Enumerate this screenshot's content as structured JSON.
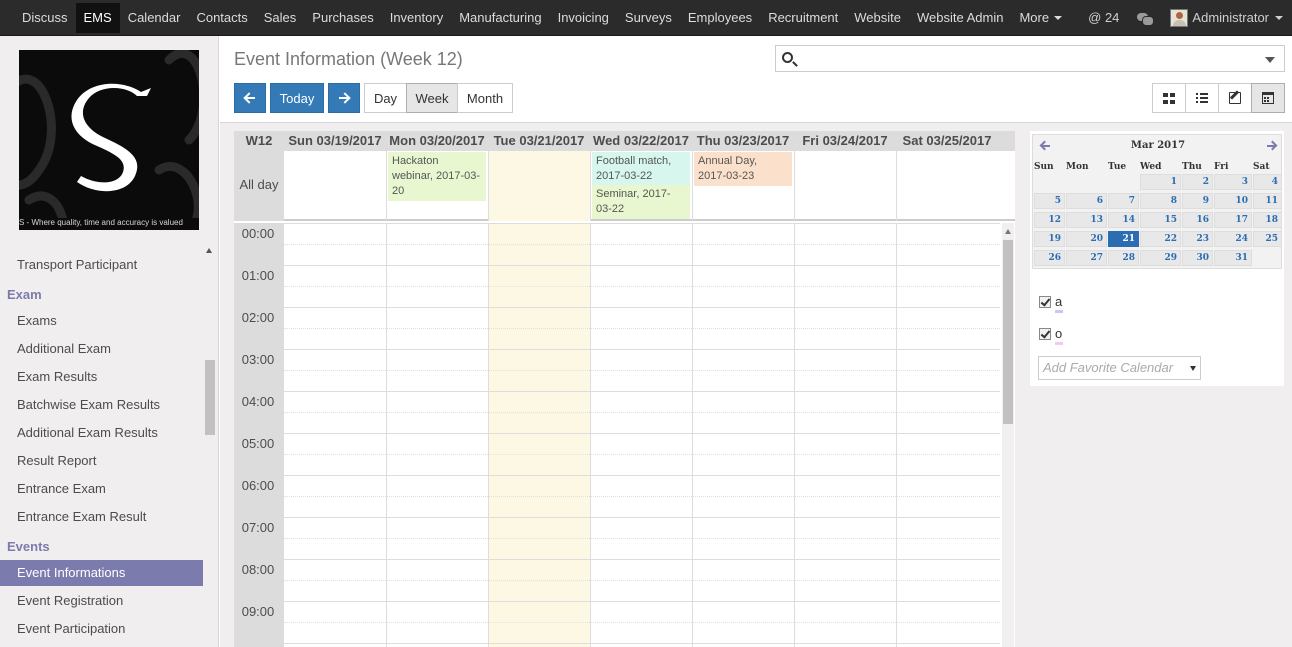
{
  "nav": {
    "items": [
      {
        "label": "Discuss"
      },
      {
        "label": "EMS",
        "active": true
      },
      {
        "label": "Calendar"
      },
      {
        "label": "Contacts"
      },
      {
        "label": "Sales"
      },
      {
        "label": "Purchases"
      },
      {
        "label": "Inventory"
      },
      {
        "label": "Manufacturing"
      },
      {
        "label": "Invoicing"
      },
      {
        "label": "Surveys"
      },
      {
        "label": "Employees"
      },
      {
        "label": "Recruitment"
      },
      {
        "label": "Website"
      },
      {
        "label": "Website Admin"
      }
    ],
    "more_label": "More",
    "mentions_count": "@ 24",
    "user_label": "Administrator"
  },
  "sidebar": {
    "logo_tagline": "S - Where quality, time and accuracy is valued",
    "items": [
      {
        "label": "Transport Participant",
        "type": "item"
      },
      {
        "label": "Exam",
        "type": "head"
      },
      {
        "label": "Exams",
        "type": "item"
      },
      {
        "label": "Additional Exam",
        "type": "item"
      },
      {
        "label": "Exam Results",
        "type": "item"
      },
      {
        "label": "Batchwise Exam Results",
        "type": "item"
      },
      {
        "label": "Additional Exam Results",
        "type": "item"
      },
      {
        "label": "Result Report",
        "type": "item"
      },
      {
        "label": "Entrance Exam",
        "type": "item"
      },
      {
        "label": "Entrance Exam Result",
        "type": "item"
      },
      {
        "label": "Events",
        "type": "head"
      },
      {
        "label": "Event Informations",
        "type": "item",
        "active": true
      },
      {
        "label": "Event Registration",
        "type": "item"
      },
      {
        "label": "Event Participation",
        "type": "item"
      }
    ]
  },
  "page": {
    "title": "Event Information (Week 12)",
    "search_placeholder": ""
  },
  "toolbar": {
    "today_label": "Today",
    "day_label": "Day",
    "week_label": "Week",
    "month_label": "Month"
  },
  "calendar": {
    "week_label": "W12",
    "allday_label": "All day",
    "days": [
      "Sun 03/19/2017",
      "Mon 03/20/2017",
      "Tue 03/21/2017",
      "Wed 03/22/2017",
      "Thu 03/23/2017",
      "Fri 03/24/2017",
      "Sat 03/25/2017"
    ],
    "today_index": 2,
    "events": [
      {
        "day": 1,
        "slot": 0,
        "text": "Hackaton webinar, 2017-03-20",
        "color": "#e9f7d1"
      },
      {
        "day": 3,
        "slot": 0,
        "text": "Football match, 2017-03-22",
        "color": "#d7f7ee"
      },
      {
        "day": 3,
        "slot": 1,
        "text": "Seminar, 2017-03-22",
        "color": "#e9f7d1"
      },
      {
        "day": 4,
        "slot": 0,
        "text": "Annual Day, 2017-03-23",
        "color": "#fbe1cb"
      }
    ],
    "hours": [
      "00:00",
      "01:00",
      "02:00",
      "03:00",
      "04:00",
      "05:00",
      "06:00",
      "07:00",
      "08:00",
      "09:00"
    ],
    "today_color": "#fcf8e3"
  },
  "mini_calendar": {
    "title": "Mar 2017",
    "weekdays": [
      "Sun",
      "Mon",
      "Tue",
      "Wed",
      "Thu",
      "Fri",
      "Sat"
    ],
    "weeks": [
      [
        "",
        "",
        "",
        "1",
        "2",
        "3",
        "4"
      ],
      [
        "5",
        "6",
        "7",
        "8",
        "9",
        "10",
        "11"
      ],
      [
        "12",
        "13",
        "14",
        "15",
        "16",
        "17",
        "18"
      ],
      [
        "19",
        "20",
        "21",
        "22",
        "23",
        "24",
        "25"
      ],
      [
        "26",
        "27",
        "28",
        "29",
        "30",
        "31",
        ""
      ]
    ],
    "selected": "21"
  },
  "favorites": {
    "items": [
      {
        "label": "a",
        "color": "#c8c8f5"
      },
      {
        "label": "o",
        "color": "#f5c8f0"
      }
    ],
    "add_placeholder": "Add Favorite Calendar"
  }
}
